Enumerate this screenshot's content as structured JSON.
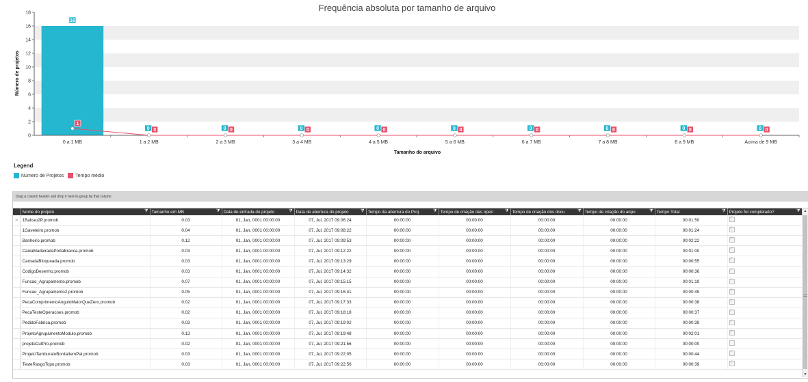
{
  "chart_data": {
    "type": "bar",
    "title": "Frequência absoluta por tamanho de arquivo",
    "xlabel": "Tamanho do arquivo",
    "ylabel": "Número de projetos",
    "ylim": [
      0,
      18
    ],
    "yticks": [
      0,
      2,
      4,
      6,
      8,
      10,
      12,
      14,
      16,
      18
    ],
    "categories": [
      "0 a 1 MB",
      "1 a 2 MB",
      "2 a 3 MB",
      "3 a 4 MB",
      "4 a 5 MB",
      "5 a 6 MB",
      "6 a 7 MB",
      "7 a 8 MB",
      "8 a 9 MB",
      "Acima de 9 MB"
    ],
    "series": [
      {
        "name": "Numero de Projetos",
        "kind": "bar",
        "color": "#26b7d0",
        "values": [
          16,
          0,
          0,
          0,
          0,
          0,
          0,
          0,
          0,
          0
        ]
      },
      {
        "name": "Tempo médio",
        "kind": "line",
        "color": "#e8506a",
        "values": [
          1,
          0,
          0,
          0,
          0,
          0,
          0,
          0,
          0,
          0
        ]
      }
    ],
    "grid": true,
    "legend_position": "bottom-left"
  },
  "legend": {
    "title": "Legend",
    "items": [
      {
        "label": "Numero de Projetos",
        "color": "#26b7d0"
      },
      {
        "label": "Tempo médio",
        "color": "#e8506a"
      }
    ]
  },
  "grid": {
    "group_hint": "Drag a column header and drop it here to group by that column",
    "filter_icon": "filter-icon",
    "columns": [
      "Nome do projeto",
      "Tamanho em MB",
      "Data de entrada do projeto",
      "Data de abertura do projeto",
      "Tempo da abertura do Proj",
      "Tempo de criação das open",
      "Tempo de criação dos docu",
      "Tempo de criação do arqui",
      "Tempo Total",
      "Projeto foi completado?"
    ],
    "current_row_marker": ">",
    "rows": [
      {
        "name": "1Balcao2P.promob",
        "size": "0.03",
        "entry": "01, Jan, 0001 00:00:00",
        "open": "07, Jul, 2017 09:06:24",
        "t1": "00:00:00",
        "t2": "00:00:00",
        "t3": "00:00:00",
        "t4": "00:00:00",
        "total": "00:01:50",
        "done": true
      },
      {
        "name": "1Gaveteiro.promob",
        "size": "0.04",
        "entry": "01, Jan, 0001 00:00:00",
        "open": "07, Jul, 2017 09:08:22",
        "t1": "00:00:00",
        "t2": "00:00:00",
        "t3": "00:00:00",
        "t4": "00:00:00",
        "total": "00:01:24",
        "done": true
      },
      {
        "name": "Banheiro.promob",
        "size": "0.12",
        "entry": "01, Jan, 0001 00:00:00",
        "open": "07, Jul, 2017 09:09:53",
        "t1": "00:00:00",
        "t2": "00:00:00",
        "t3": "00:00:00",
        "t4": "00:00:00",
        "total": "00:02:22",
        "done": true
      },
      {
        "name": "CaixaMadeiradaPortaBranca.promob",
        "size": "0.03",
        "entry": "01, Jan, 0001 00:00:00",
        "open": "07, Jul, 2017 09:12:22",
        "t1": "00:00:00",
        "t2": "00:00:00",
        "t3": "00:00:00",
        "t4": "00:00:00",
        "total": "00:01:00",
        "done": true
      },
      {
        "name": "CamadaBloqueada.promob",
        "size": "0.03",
        "entry": "01, Jan, 0001 00:00:00",
        "open": "07, Jul, 2017 09:13:29",
        "t1": "00:00:00",
        "t2": "00:00:00",
        "t3": "00:00:00",
        "t4": "00:00:00",
        "total": "00:00:55",
        "done": true
      },
      {
        "name": "CodigoDesenho.promob",
        "size": "0.03",
        "entry": "01, Jan, 0001 00:00:00",
        "open": "07, Jul, 2017 09:14:32",
        "t1": "00:00:00",
        "t2": "00:00:00",
        "t3": "00:00:00",
        "t4": "00:00:00",
        "total": "00:00:36",
        "done": true
      },
      {
        "name": "Funcao_Agrupamento.promob",
        "size": "0.07",
        "entry": "01, Jan, 0001 00:00:00",
        "open": "07, Jul, 2017 09:15:15",
        "t1": "00:00:00",
        "t2": "00:00:00",
        "t3": "00:00:00",
        "t4": "00:00:00",
        "total": "00:01:19",
        "done": true
      },
      {
        "name": "Funcao_Agrupamento2.promob",
        "size": "0.05",
        "entry": "01, Jan, 0001 00:00:00",
        "open": "07, Jul, 2017 09:16:41",
        "t1": "00:00:00",
        "t2": "00:00:00",
        "t3": "00:00:00",
        "t4": "00:00:00",
        "total": "00:00:45",
        "done": true
      },
      {
        "name": "PecaComprimentoAnguloMaiorQueZero.promob",
        "size": "0.02",
        "entry": "01, Jan, 0001 00:00:00",
        "open": "07, Jul, 2017 09:17:33",
        "t1": "00:00:00",
        "t2": "00:00:00",
        "t3": "00:00:00",
        "t4": "00:00:00",
        "total": "00:00:38",
        "done": true
      },
      {
        "name": "PecaTesteOperacoes.promob",
        "size": "0.02",
        "entry": "01, Jan, 0001 00:00:00",
        "open": "07, Jul, 2017 09:18:18",
        "t1": "00:00:00",
        "t2": "00:00:00",
        "t3": "00:00:00",
        "t4": "00:00:00",
        "total": "00:00:37",
        "done": true
      },
      {
        "name": "PedidoFabrica.promob",
        "size": "0.03",
        "entry": "01, Jan, 0001 00:00:00",
        "open": "07, Jul, 2017 09:19:02",
        "t1": "00:00:00",
        "t2": "00:00:00",
        "t3": "00:00:00",
        "t4": "00:00:00",
        "total": "00:00:39",
        "done": true
      },
      {
        "name": "ProjetoAgrupamentoModulo.promob",
        "size": "0.13",
        "entry": "01, Jan, 0001 00:00:00",
        "open": "07, Jul, 2017 09:19:48",
        "t1": "00:00:00",
        "t2": "00:00:00",
        "t3": "00:00:00",
        "t4": "00:00:00",
        "total": "00:02:01",
        "done": true
      },
      {
        "name": "projetoCutPro.promob",
        "size": "0.02",
        "entry": "01, Jan, 0001 00:00:00",
        "open": "07, Jul, 2017 09:21:56",
        "t1": "00:00:00",
        "t2": "00:00:00",
        "t3": "00:00:00",
        "t4": "00:00:00",
        "total": "00:00:00",
        "done": false
      },
      {
        "name": "ProjetoTamburatoBordaItemPai.promob",
        "size": "0.03",
        "entry": "01, Jan, 0001 00:00:00",
        "open": "07, Jul, 2017 09:22:05",
        "t1": "00:00:00",
        "t2": "00:00:00",
        "t3": "00:00:00",
        "t4": "00:00:00",
        "total": "00:00:44",
        "done": true
      },
      {
        "name": "TesteRasgoTopo.promob",
        "size": "0.03",
        "entry": "01, Jan, 0001 00:00:00",
        "open": "07, Jul, 2017 09:22:56",
        "t1": "00:00:00",
        "t2": "00:00:00",
        "t3": "00:00:00",
        "t4": "00:00:00",
        "total": "00:00:39",
        "done": true
      }
    ]
  }
}
